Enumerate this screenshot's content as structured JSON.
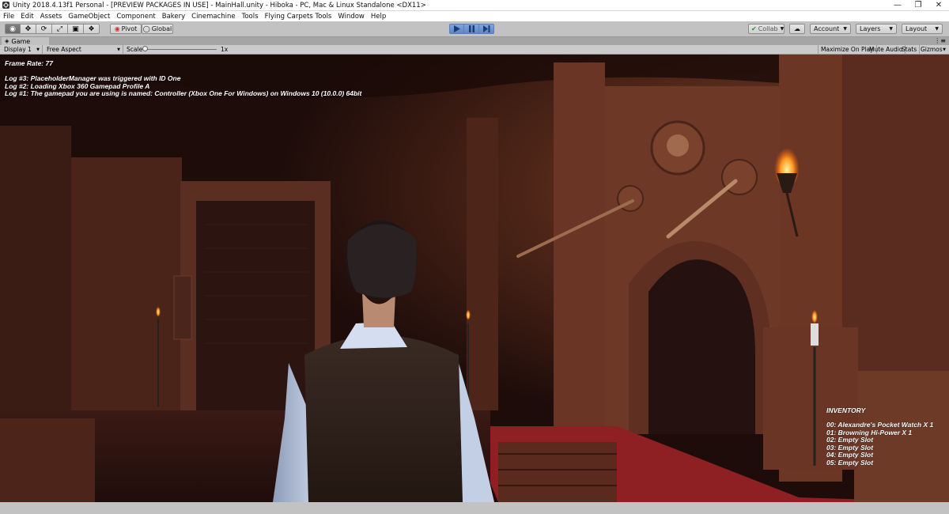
{
  "window": {
    "title": "Unity 2018.4.13f1 Personal - [PREVIEW PACKAGES IN USE] - MainHall.unity - Hiboka - PC, Mac & Linux Standalone <DX11>"
  },
  "menu": [
    "File",
    "Edit",
    "Assets",
    "GameObject",
    "Component",
    "Bakery",
    "Cinemachine",
    "Tools",
    "Flying Carpets Tools",
    "Window",
    "Help"
  ],
  "toolbar": {
    "pivot_label": "Pivot",
    "global_label": "Global",
    "collab_label": "Collab",
    "account_label": "Account",
    "layers_label": "Layers",
    "layout_label": "Layout"
  },
  "game_panel": {
    "tab_label": "Game",
    "display": "Display 1",
    "aspect": "Free Aspect",
    "scale_label": "Scale",
    "scale_value": "1x",
    "maximize_label": "Maximize On Play",
    "mute_label": "Mute Audio",
    "stats_label": "Stats",
    "gizmos_label": "Gizmos"
  },
  "hud": {
    "frame_rate": "Frame Rate: 77",
    "logs": [
      "Log #3: PlaceholderManager was triggered with ID One",
      "Log #2: Loading Xbox 360 Gamepad Profile A",
      "Log #1: The gamepad you are using is named: Controller (Xbox One For Windows) on Windows 10  (10.0.0) 64bit"
    ],
    "inventory_title": "INVENTORY",
    "inventory": [
      "00: Alexandre's Pocket Watch X 1",
      "01: Browning Hi-Power X 1",
      "02: Empty Slot",
      "03: Empty Slot",
      "04: Empty Slot",
      "05: Empty Slot"
    ]
  },
  "colors": {
    "accent_play": "#6f93cc",
    "scene_dark": "#2a1210",
    "scene_brick": "#6b3a2c",
    "carpet": "#8e1f22"
  }
}
